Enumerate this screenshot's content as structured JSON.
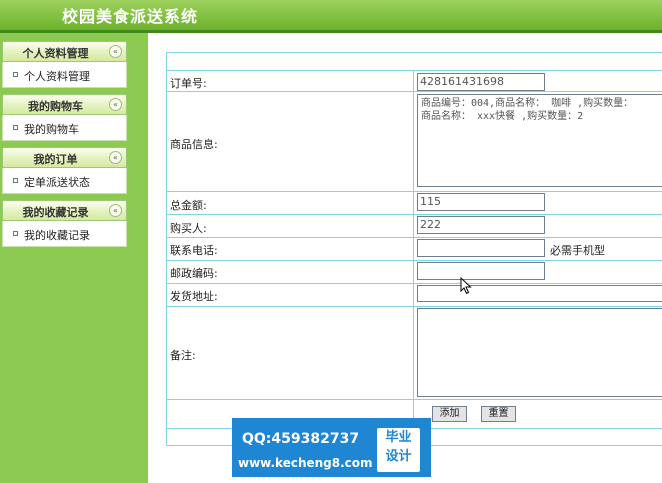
{
  "app": {
    "title": "校园美食派送系统"
  },
  "sidebar": {
    "groups": [
      {
        "title": "个人资料管理",
        "item": "个人资料管理"
      },
      {
        "title": "我的购物车",
        "item": "我的购物车"
      },
      {
        "title": "我的订单",
        "item": "定单派送状态"
      },
      {
        "title": "我的收藏记录",
        "item": "我的收藏记录"
      }
    ],
    "collapse_glyph": "«"
  },
  "form": {
    "order_no": {
      "label": "订单号:",
      "value": "428161431698"
    },
    "goods": {
      "label": "商品信息:",
      "value": "商品编号：004,商品名称： 咖啡 ,购买数量：\n商品名称： xxx快餐 ,购买数量：2"
    },
    "total": {
      "label": "总金额:",
      "value": "115"
    },
    "buyer": {
      "label": "购买人:",
      "value": "222"
    },
    "phone": {
      "label": "联系电话:",
      "value": "",
      "hint": "必需手机型"
    },
    "postcode": {
      "label": "邮政编码:",
      "value": ""
    },
    "address": {
      "label": "发货地址:",
      "value": ""
    },
    "remark": {
      "label": "备注:",
      "value": ""
    },
    "buttons": {
      "add": "添加",
      "reset": "重置"
    }
  },
  "watermark": {
    "qq": "QQ:459382737",
    "site": "www.kecheng8.com",
    "badge_line1": "毕业",
    "badge_line2": "设计"
  }
}
